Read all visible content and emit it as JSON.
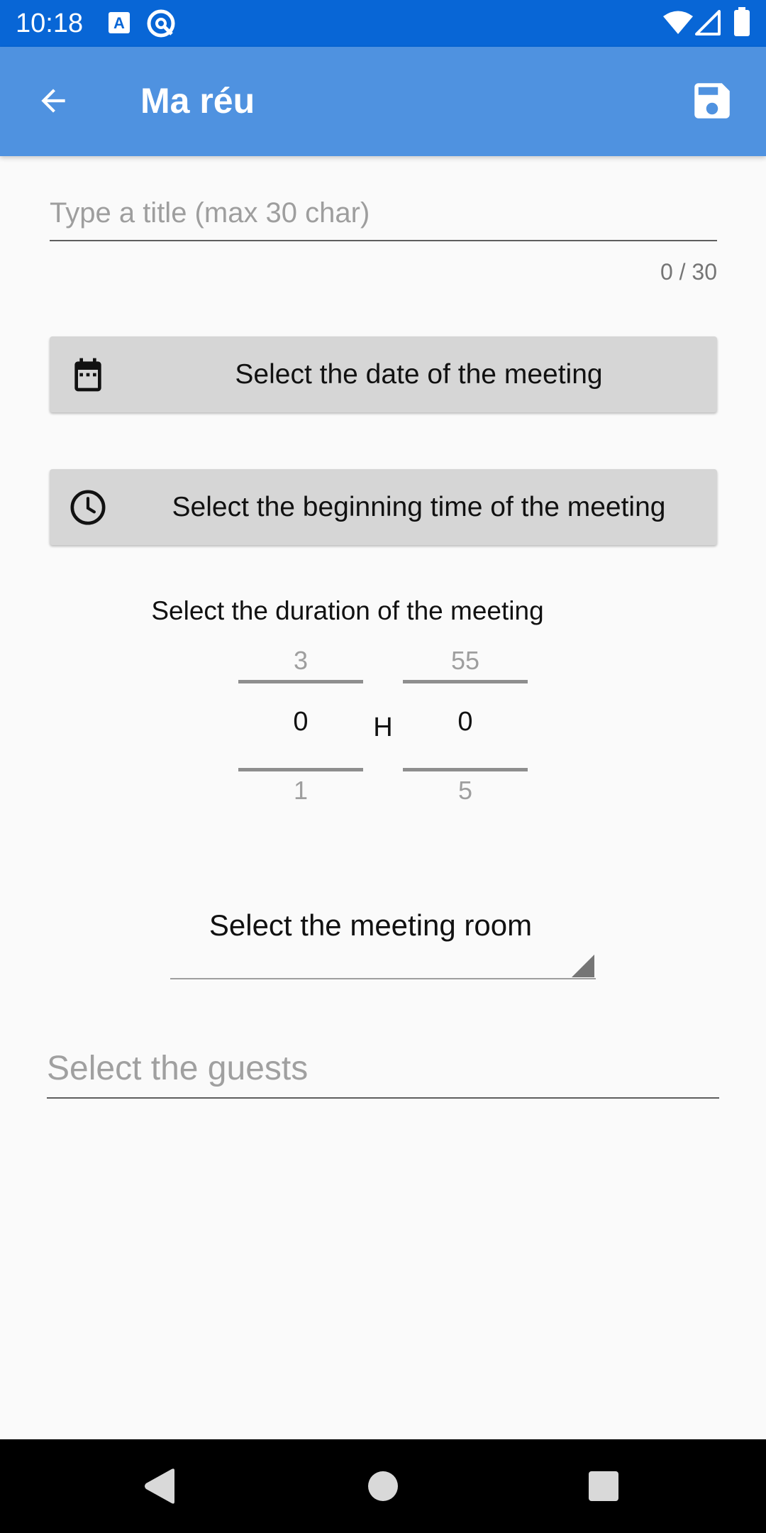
{
  "status_bar": {
    "time": "10:18",
    "icons": [
      "keyboard-a-icon",
      "at-sync-icon",
      "wifi-icon",
      "cell-signal-icon",
      "battery-icon"
    ],
    "background": "#0866D6"
  },
  "app_bar": {
    "title": "Ma réu",
    "back_icon": "arrow-back-icon",
    "save_icon": "floppy-save-icon",
    "background": "#4F92E0"
  },
  "form": {
    "title_placeholder": "Type a title (max 30 char)",
    "title_value": "",
    "title_counter": "0 / 30",
    "date_button_label": "Select the date of the meeting",
    "date_button_icon": "calendar-icon",
    "time_button_label": "Select the beginning time of the meeting",
    "time_button_icon": "clock-icon",
    "button_background": "#D6D6D6",
    "duration_label": "Select the duration of the meeting",
    "hours_picker": {
      "prev": "3",
      "current": "0",
      "next": "1"
    },
    "separator": "H",
    "minutes_picker": {
      "prev": "55",
      "current": "0",
      "next": "5"
    },
    "room_spinner_label": "Select the meeting room",
    "guests_placeholder": "Select the guests",
    "guests_value": ""
  },
  "nav_bar": {
    "back_icon": "nav-back-triangle-icon",
    "home_icon": "nav-home-circle-icon",
    "recents_icon": "nav-recents-square-icon"
  }
}
